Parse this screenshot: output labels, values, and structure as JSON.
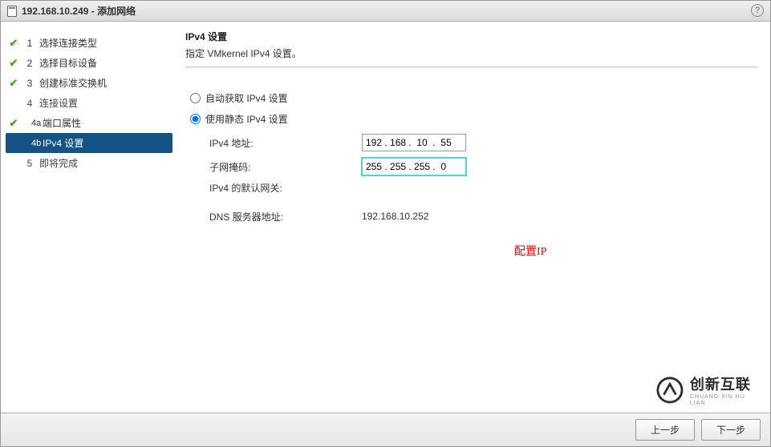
{
  "titlebar": {
    "title": "192.168.10.249 - 添加网络",
    "help_tooltip": "?"
  },
  "sidebar": {
    "steps": [
      {
        "num": "1",
        "label": "选择连接类型",
        "done": true,
        "indent": false,
        "active": false
      },
      {
        "num": "2",
        "label": "选择目标设备",
        "done": true,
        "indent": false,
        "active": false
      },
      {
        "num": "3",
        "label": "创建标准交换机",
        "done": true,
        "indent": false,
        "active": false
      },
      {
        "num": "4",
        "label": "连接设置",
        "done": false,
        "indent": false,
        "active": false
      },
      {
        "num": "4a",
        "label": "端口属性",
        "done": true,
        "indent": true,
        "active": false
      },
      {
        "num": "4b",
        "label": "IPv4 设置",
        "done": false,
        "indent": true,
        "active": true
      },
      {
        "num": "5",
        "label": "即将完成",
        "done": false,
        "indent": false,
        "active": false
      }
    ]
  },
  "main": {
    "title": "IPv4 设置",
    "subtitle": "指定 VMkernel IPv4 设置。",
    "radio_auto_label": "自动获取 IPv4 设置",
    "radio_static_label": "使用静态 IPv4 设置",
    "selected_radio": "static",
    "fields": {
      "ipv4_label": "IPv4 地址:",
      "ipv4_value": "192 . 168 .  10  .  55",
      "subnet_label": "子网掩码:",
      "subnet_value": "255 . 255 . 255 .  0",
      "gateway_label": "IPv4 的默认网关:",
      "gateway_value": "",
      "dns_label": "DNS 服务器地址:",
      "dns_value": "192.168.10.252"
    },
    "annotation": "配置IP"
  },
  "footer": {
    "back_label": "上一步",
    "next_label": "下一步"
  },
  "logo": {
    "text": "创新互联",
    "sub": "CHUANG XIN HU LIAN"
  }
}
